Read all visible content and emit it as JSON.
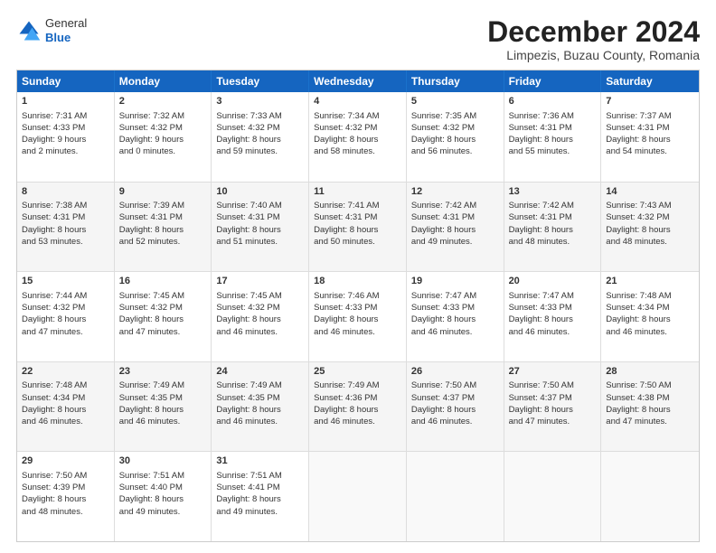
{
  "header": {
    "logo_general": "General",
    "logo_blue": "Blue",
    "month_title": "December 2024",
    "subtitle": "Limpezis, Buzau County, Romania"
  },
  "weekdays": [
    "Sunday",
    "Monday",
    "Tuesday",
    "Wednesday",
    "Thursday",
    "Friday",
    "Saturday"
  ],
  "rows": [
    [
      {
        "day": "1",
        "lines": [
          "Sunrise: 7:31 AM",
          "Sunset: 4:33 PM",
          "Daylight: 9 hours",
          "and 2 minutes."
        ]
      },
      {
        "day": "2",
        "lines": [
          "Sunrise: 7:32 AM",
          "Sunset: 4:32 PM",
          "Daylight: 9 hours",
          "and 0 minutes."
        ]
      },
      {
        "day": "3",
        "lines": [
          "Sunrise: 7:33 AM",
          "Sunset: 4:32 PM",
          "Daylight: 8 hours",
          "and 59 minutes."
        ]
      },
      {
        "day": "4",
        "lines": [
          "Sunrise: 7:34 AM",
          "Sunset: 4:32 PM",
          "Daylight: 8 hours",
          "and 58 minutes."
        ]
      },
      {
        "day": "5",
        "lines": [
          "Sunrise: 7:35 AM",
          "Sunset: 4:32 PM",
          "Daylight: 8 hours",
          "and 56 minutes."
        ]
      },
      {
        "day": "6",
        "lines": [
          "Sunrise: 7:36 AM",
          "Sunset: 4:31 PM",
          "Daylight: 8 hours",
          "and 55 minutes."
        ]
      },
      {
        "day": "7",
        "lines": [
          "Sunrise: 7:37 AM",
          "Sunset: 4:31 PM",
          "Daylight: 8 hours",
          "and 54 minutes."
        ]
      }
    ],
    [
      {
        "day": "8",
        "lines": [
          "Sunrise: 7:38 AM",
          "Sunset: 4:31 PM",
          "Daylight: 8 hours",
          "and 53 minutes."
        ]
      },
      {
        "day": "9",
        "lines": [
          "Sunrise: 7:39 AM",
          "Sunset: 4:31 PM",
          "Daylight: 8 hours",
          "and 52 minutes."
        ]
      },
      {
        "day": "10",
        "lines": [
          "Sunrise: 7:40 AM",
          "Sunset: 4:31 PM",
          "Daylight: 8 hours",
          "and 51 minutes."
        ]
      },
      {
        "day": "11",
        "lines": [
          "Sunrise: 7:41 AM",
          "Sunset: 4:31 PM",
          "Daylight: 8 hours",
          "and 50 minutes."
        ]
      },
      {
        "day": "12",
        "lines": [
          "Sunrise: 7:42 AM",
          "Sunset: 4:31 PM",
          "Daylight: 8 hours",
          "and 49 minutes."
        ]
      },
      {
        "day": "13",
        "lines": [
          "Sunrise: 7:42 AM",
          "Sunset: 4:31 PM",
          "Daylight: 8 hours",
          "and 48 minutes."
        ]
      },
      {
        "day": "14",
        "lines": [
          "Sunrise: 7:43 AM",
          "Sunset: 4:32 PM",
          "Daylight: 8 hours",
          "and 48 minutes."
        ]
      }
    ],
    [
      {
        "day": "15",
        "lines": [
          "Sunrise: 7:44 AM",
          "Sunset: 4:32 PM",
          "Daylight: 8 hours",
          "and 47 minutes."
        ]
      },
      {
        "day": "16",
        "lines": [
          "Sunrise: 7:45 AM",
          "Sunset: 4:32 PM",
          "Daylight: 8 hours",
          "and 47 minutes."
        ]
      },
      {
        "day": "17",
        "lines": [
          "Sunrise: 7:45 AM",
          "Sunset: 4:32 PM",
          "Daylight: 8 hours",
          "and 46 minutes."
        ]
      },
      {
        "day": "18",
        "lines": [
          "Sunrise: 7:46 AM",
          "Sunset: 4:33 PM",
          "Daylight: 8 hours",
          "and 46 minutes."
        ]
      },
      {
        "day": "19",
        "lines": [
          "Sunrise: 7:47 AM",
          "Sunset: 4:33 PM",
          "Daylight: 8 hours",
          "and 46 minutes."
        ]
      },
      {
        "day": "20",
        "lines": [
          "Sunrise: 7:47 AM",
          "Sunset: 4:33 PM",
          "Daylight: 8 hours",
          "and 46 minutes."
        ]
      },
      {
        "day": "21",
        "lines": [
          "Sunrise: 7:48 AM",
          "Sunset: 4:34 PM",
          "Daylight: 8 hours",
          "and 46 minutes."
        ]
      }
    ],
    [
      {
        "day": "22",
        "lines": [
          "Sunrise: 7:48 AM",
          "Sunset: 4:34 PM",
          "Daylight: 8 hours",
          "and 46 minutes."
        ]
      },
      {
        "day": "23",
        "lines": [
          "Sunrise: 7:49 AM",
          "Sunset: 4:35 PM",
          "Daylight: 8 hours",
          "and 46 minutes."
        ]
      },
      {
        "day": "24",
        "lines": [
          "Sunrise: 7:49 AM",
          "Sunset: 4:35 PM",
          "Daylight: 8 hours",
          "and 46 minutes."
        ]
      },
      {
        "day": "25",
        "lines": [
          "Sunrise: 7:49 AM",
          "Sunset: 4:36 PM",
          "Daylight: 8 hours",
          "and 46 minutes."
        ]
      },
      {
        "day": "26",
        "lines": [
          "Sunrise: 7:50 AM",
          "Sunset: 4:37 PM",
          "Daylight: 8 hours",
          "and 46 minutes."
        ]
      },
      {
        "day": "27",
        "lines": [
          "Sunrise: 7:50 AM",
          "Sunset: 4:37 PM",
          "Daylight: 8 hours",
          "and 47 minutes."
        ]
      },
      {
        "day": "28",
        "lines": [
          "Sunrise: 7:50 AM",
          "Sunset: 4:38 PM",
          "Daylight: 8 hours",
          "and 47 minutes."
        ]
      }
    ],
    [
      {
        "day": "29",
        "lines": [
          "Sunrise: 7:50 AM",
          "Sunset: 4:39 PM",
          "Daylight: 8 hours",
          "and 48 minutes."
        ]
      },
      {
        "day": "30",
        "lines": [
          "Sunrise: 7:51 AM",
          "Sunset: 4:40 PM",
          "Daylight: 8 hours",
          "and 49 minutes."
        ]
      },
      {
        "day": "31",
        "lines": [
          "Sunrise: 7:51 AM",
          "Sunset: 4:41 PM",
          "Daylight: 8 hours",
          "and 49 minutes."
        ]
      },
      {
        "day": "",
        "lines": []
      },
      {
        "day": "",
        "lines": []
      },
      {
        "day": "",
        "lines": []
      },
      {
        "day": "",
        "lines": []
      }
    ]
  ]
}
